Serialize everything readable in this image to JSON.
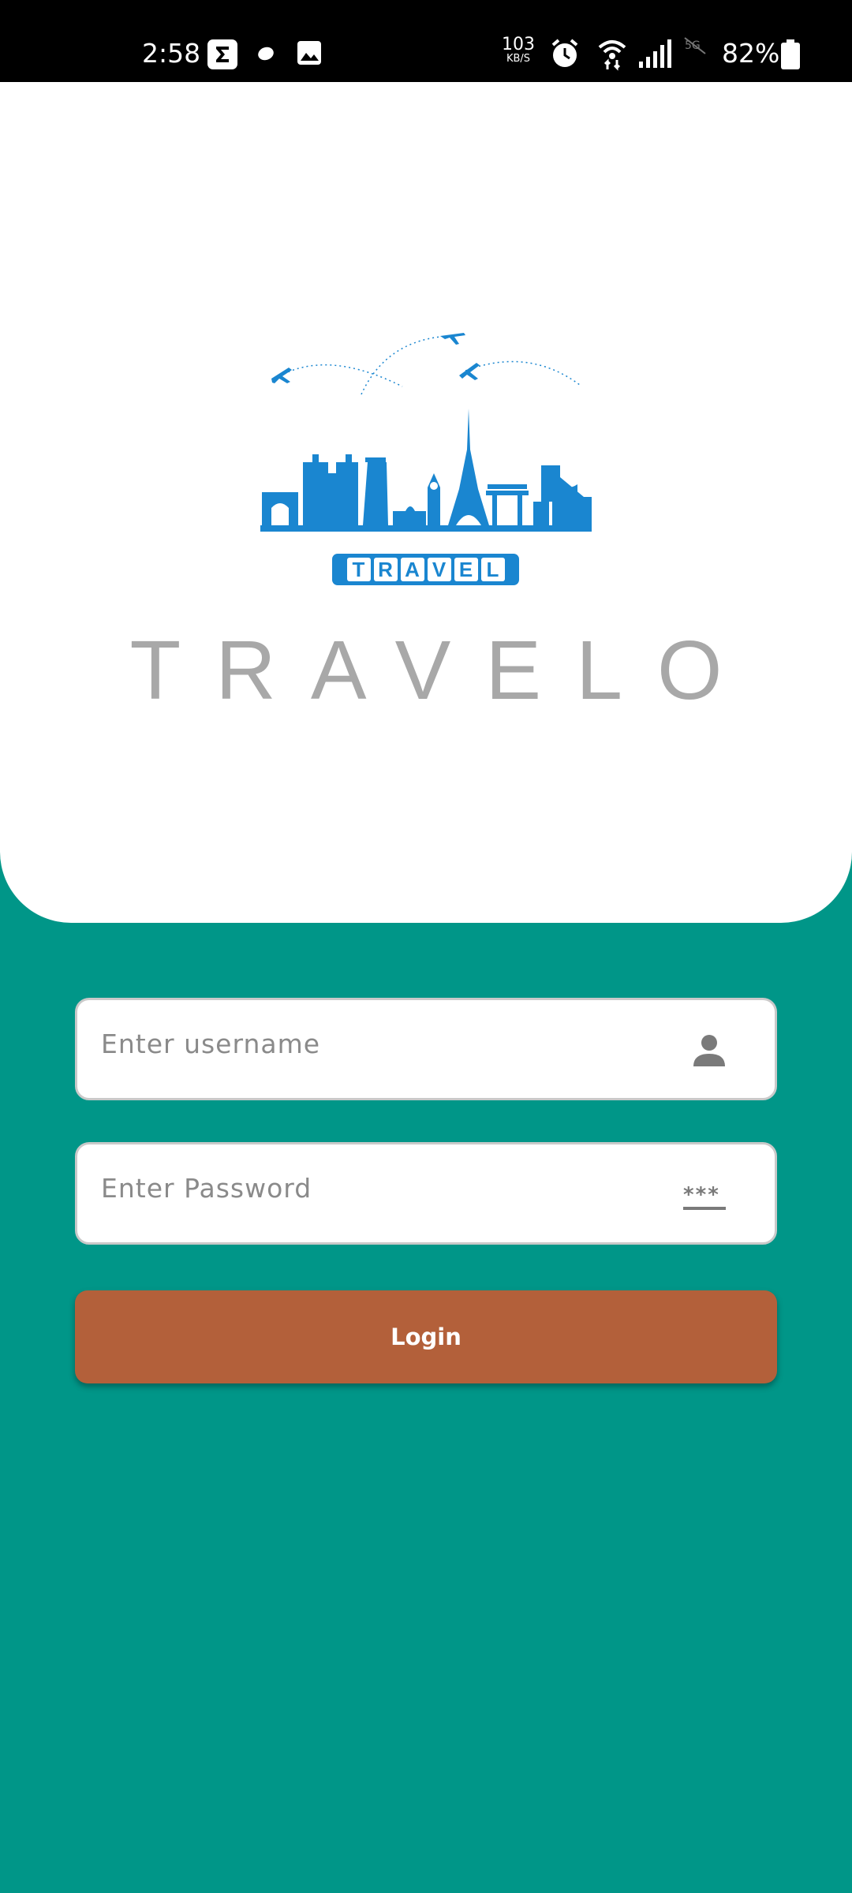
{
  "status_bar": {
    "time": "2:58",
    "net_speed_value": "103",
    "net_speed_unit": "KB/S",
    "battery": "82%",
    "icons": [
      "sigma-app-icon",
      "dot-icon",
      "image-icon",
      "alarm-icon",
      "wifi-icon",
      "signal-icon",
      "no-5g-icon",
      "battery-icon"
    ]
  },
  "logo": {
    "badge_letters": [
      "T",
      "R",
      "A",
      "V",
      "E",
      "L"
    ],
    "accent_color": "#1a86d0"
  },
  "app_title": "TRAVELO",
  "form": {
    "username_placeholder": "Enter username",
    "password_placeholder": "Enter Password",
    "password_icon_text": "***",
    "login_label": "Login"
  },
  "colors": {
    "background": "#009688",
    "card": "#ffffff",
    "button": "#b3603a",
    "title": "#a8a8a8"
  }
}
